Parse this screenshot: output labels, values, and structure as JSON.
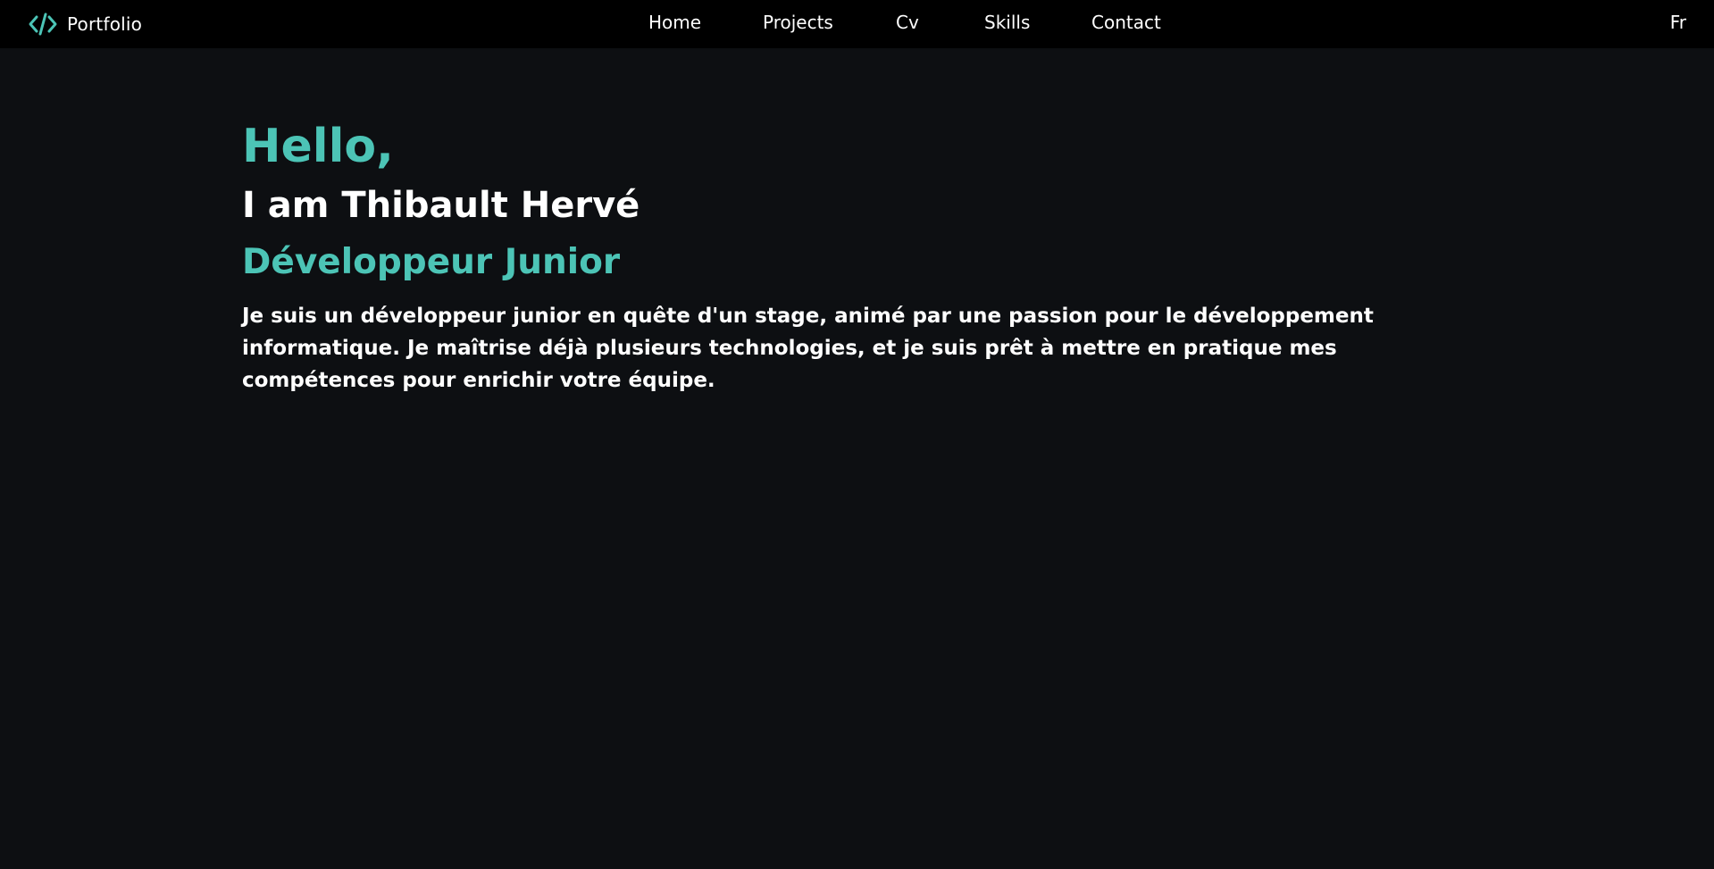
{
  "colors": {
    "accent": "#4cc4b6",
    "navbar_bg": "#000000",
    "page_bg": "#0d0f12",
    "text": "#ffffff"
  },
  "navbar": {
    "brand": {
      "icon": "code-icon",
      "label": "Portfolio"
    },
    "links": [
      {
        "label": "Home"
      },
      {
        "label": "Projects"
      },
      {
        "label": "Cv"
      },
      {
        "label": "Skills"
      },
      {
        "label": "Contact"
      }
    ],
    "language": "Fr"
  },
  "hero": {
    "greeting": "Hello,",
    "name": "I am Thibault Hervé",
    "role": "Développeur Junior",
    "description": "Je suis un développeur junior en quête d'un stage, animé par une passion pour le développement informatique. Je maîtrise déjà plusieurs technologies, et je suis prêt à mettre en pratique mes compétences pour enrichir votre équipe."
  }
}
